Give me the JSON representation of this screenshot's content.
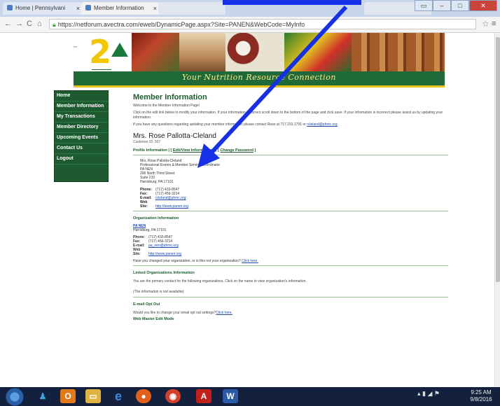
{
  "browser": {
    "tabs": [
      {
        "label": "Home | Pennsylvani"
      },
      {
        "label": "Member Information"
      }
    ],
    "url": "https://netforum.avectra.com/eweb/DynamicPage.aspx?Site=PANEN&WebCode=MyInfo"
  },
  "site": {
    "tagline": "Your Nutrition Resource Connection"
  },
  "nav": {
    "items": [
      {
        "label": "Home"
      },
      {
        "label": "Member Information"
      },
      {
        "label": "My Transactions"
      },
      {
        "label": "Member Directory"
      },
      {
        "label": "Upcoming Events"
      },
      {
        "label": "Contact Us"
      },
      {
        "label": "Logout"
      }
    ]
  },
  "main": {
    "heading": "Member Information",
    "welcome": "Welcome to the Member Information Page!",
    "instructions": "Click on the edit link below to modify your information. If your information is correct scroll down to the bottom of the page and click save. If your information is incorrect please assist us by updating your information.",
    "questions_prefix": "If you have any questions regarding updating your member information please contact Rose at 717.233.1791 or",
    "questions_email": "rcleland@phmc.org",
    "member_name": "Mrs. Rose Pallotta-Cleland",
    "customer_id": "Customer ID: 507",
    "tab_profile": "Profile Information |",
    "tab_edit": "Edit/View Information",
    "tab_password": "Change Password",
    "address_lines": [
      "Mrs. Rose Pallotta-Cleland",
      "Professional Events & Member Service Coordinator",
      "PA NEN",
      "206 North Third Street",
      "Suite 210",
      "Harrisburg, PA 17101"
    ],
    "contact": {
      "phone_label": "Phone:",
      "phone": "(717) 433-8547",
      "fax_label": "Fax:",
      "fax": "(717) 456-3214",
      "email_label": "E-mail:",
      "email": "rcleland@phmc.org",
      "web_label": "Web Site:",
      "web": "http://www.panen.org"
    },
    "org_heading": "Organization Information",
    "org_name": "PA NEN",
    "org_city": "Harrisburg, PA 17101",
    "org_contact": {
      "phone": "(717) 433-8547",
      "fax": "(717) 456-3214",
      "email": "pa_nen@phmc.org",
      "web": "http://www.panen.org"
    },
    "org_change_text": "Have you changed your organization, or is this not your organization?",
    "org_change_link": "Click here.",
    "linked_heading": "Linked Organizations Information",
    "linked_text": "You are the primary contact for the following organizations. Click on the name to view organization's information.",
    "linked_empty": "(The information is not available)",
    "optout_heading": "E-mail Opt Out",
    "optout_text": "Would you like to change your email opt out settings?",
    "optout_link": "Click here.",
    "webmaster_heading": "Web Master Edit Mode"
  },
  "taskbar": {
    "clock_time": "9:25 AM",
    "clock_date": "9/8/2016"
  },
  "colors": {
    "brand_green": "#1d5a2f",
    "accent_gold": "#e8c220",
    "annotation_blue": "#1530e6"
  }
}
